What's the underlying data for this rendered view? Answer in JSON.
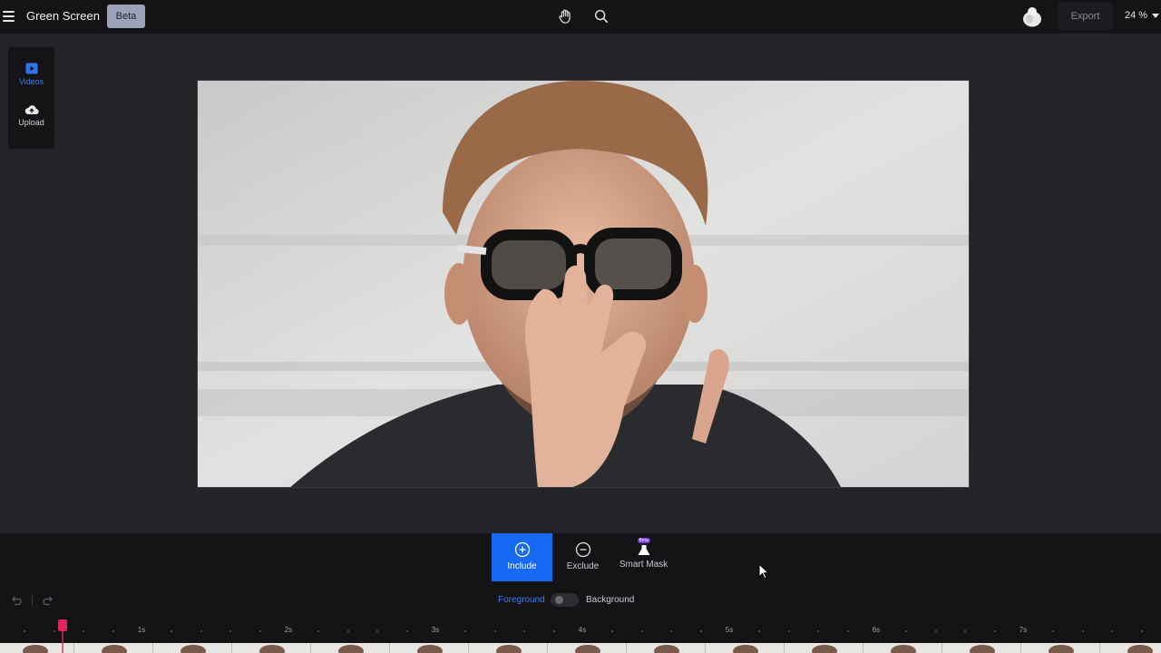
{
  "header": {
    "title": "Green Screen",
    "beta_label": "Beta",
    "export_label": "Export",
    "zoom": "24 %",
    "icons": [
      "menu-icon",
      "hand-icon",
      "search-icon",
      "avatar-icon"
    ]
  },
  "sidebar": {
    "items": [
      {
        "label": "Videos",
        "icon": "video-play-icon",
        "active": true
      },
      {
        "label": "Upload",
        "icon": "cloud-upload-icon",
        "active": false
      }
    ]
  },
  "tools": {
    "include_label": "Include",
    "exclude_label": "Exclude",
    "smart_mask_label": "Smart Mask",
    "smart_mask_badge": "Beta",
    "active_tool": "Include"
  },
  "layer_toggle": {
    "foreground_label": "Foreground",
    "background_label": "Background",
    "selected": "Foreground"
  },
  "timeline": {
    "tick_labels": [
      "1s",
      "2s",
      "3s",
      "4s",
      "5s",
      "6s",
      "7s"
    ],
    "playhead_seconds": 0.46
  },
  "colors": {
    "accent": "#1669f2",
    "active_text": "#3d7ef0",
    "playhead": "#e0245e",
    "panel": "#141416",
    "workspace": "#232427"
  }
}
